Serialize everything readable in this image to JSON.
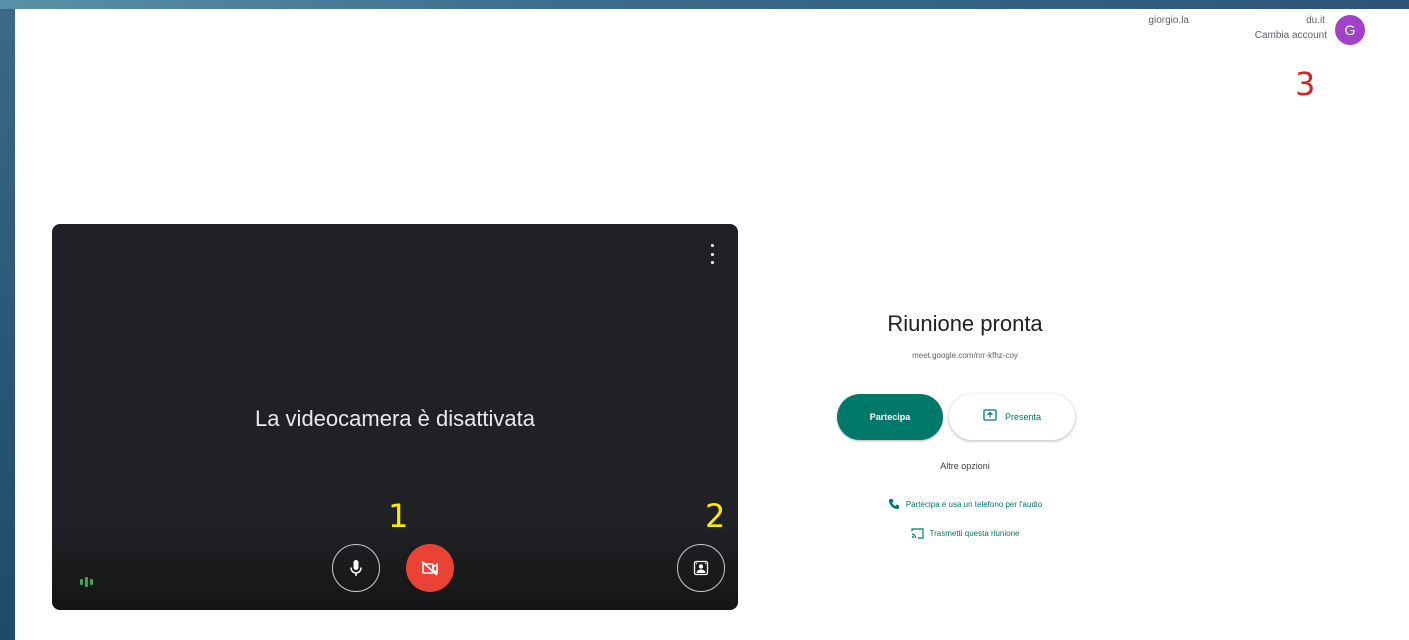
{
  "account": {
    "email_prefix": "giorgio.la",
    "email_suffix": "du.it",
    "switch_label": "Cambia account",
    "avatar_letter": "G"
  },
  "markers": {
    "one": "1",
    "two": "2",
    "three": "3"
  },
  "preview": {
    "camera_off_text": "La videocamera è disattivata",
    "mic_icon": "mic-icon",
    "camera_icon": "videocam-off-icon",
    "effects_icon": "visual-effects-icon",
    "more_icon": "more-vert-icon"
  },
  "join": {
    "title": "Riunione pronta",
    "meeting_url": "meet.google.com/nrr-kfhz-coy",
    "join_label": "Partecipa",
    "present_label": "Presenta",
    "more_options": "Altre opzioni",
    "phone_option": "Partecipa e usa un telefono per l'audio",
    "cast_option": "Trasmetti questa riunione"
  },
  "colors": {
    "accent": "#00796b",
    "camera_off_button": "#ea4335",
    "avatar": "#a142c8",
    "video_bg": "#202124"
  }
}
